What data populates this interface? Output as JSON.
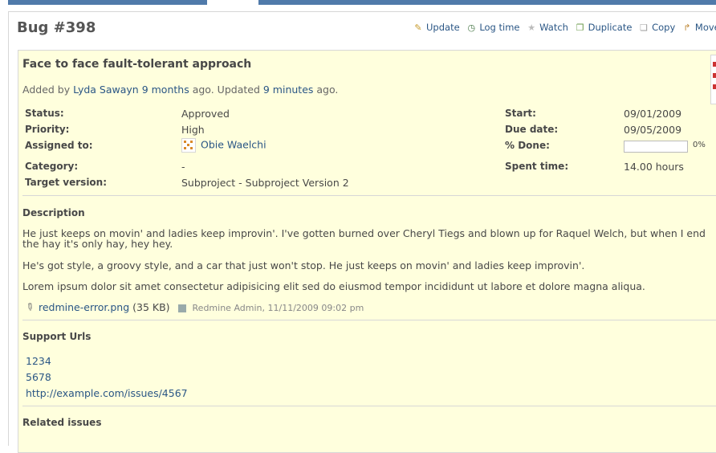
{
  "issue": {
    "title": "Bug #398",
    "subject": "Face to face fault-tolerant approach",
    "added_by_prefix": "Added by",
    "author": "Lyda Sawayn",
    "created": "9 months",
    "ago_updated": "ago. Updated",
    "updated": "9 minutes",
    "ago_end": "ago."
  },
  "contextual": {
    "update": "Update",
    "log_time": "Log time",
    "watch": "Watch",
    "duplicate": "Duplicate",
    "copy": "Copy",
    "move": "Move"
  },
  "attributes": {
    "status_label": "Status:",
    "status": "Approved",
    "priority_label": "Priority:",
    "priority": "High",
    "assigned_label": "Assigned to:",
    "assigned": "Obie Waelchi",
    "category_label": "Category:",
    "category": "-",
    "target_label": "Target version:",
    "target": "Subproject - Subproject Version 2",
    "start_label": "Start:",
    "start": "09/01/2009",
    "due_label": "Due date:",
    "due": "09/05/2009",
    "done_label": "% Done:",
    "done_text": "0%",
    "done_fraction": 0,
    "spent_label": "Spent time:",
    "spent": "14.00 hours"
  },
  "description": {
    "title": "Description",
    "p1": "He just keeps on movin' and ladies keep improvin'. I've gotten burned over Cheryl Tiegs and blown up for Raquel Welch, but when I end the hay it's only hay, hey hey.",
    "p2": "He's got style, a groovy style, and a car that just won't stop. He just keeps on movin' and ladies keep improvin'.",
    "p3": "Lorem ipsum dolor sit amet consectetur adipisicing elit sed do eiusmod tempor incididunt ut labore et dolore magna aliqua."
  },
  "attachment": {
    "filename": "redmine-error.png",
    "size": "(35 KB)",
    "meta": "Redmine Admin, 11/11/2009 09:02 pm"
  },
  "support_urls": {
    "title": "Support Urls",
    "items": [
      "1234",
      "5678",
      "http://example.com/issues/4567"
    ]
  },
  "related": {
    "title": "Related issues"
  }
}
